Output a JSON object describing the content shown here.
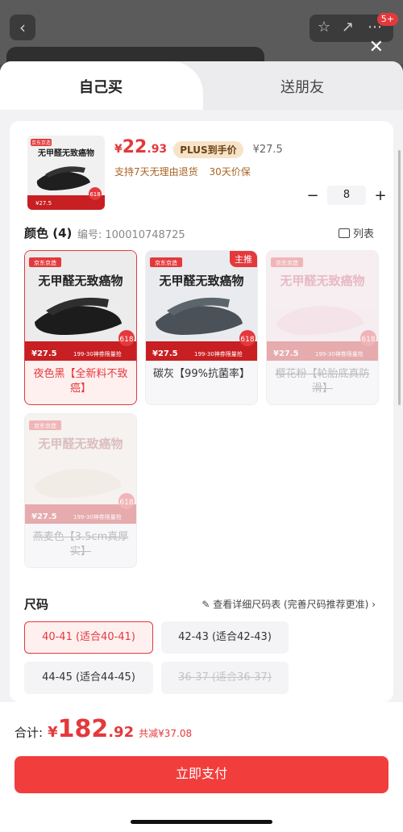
{
  "background": {
    "back_icon": "chevron-left-icon",
    "star_icon": "star-icon",
    "share_icon": "share-icon",
    "more_icon": "more-icon",
    "badge": "5+",
    "close_icon": "close-icon"
  },
  "tabs": [
    {
      "label": "自己买",
      "active": true
    },
    {
      "label": "送朋友",
      "active": false
    }
  ],
  "product": {
    "price_symbol": "¥",
    "price_int": "22",
    "price_dec": ".93",
    "plus_label": "PLUS到手价",
    "original_price": "¥27.5",
    "policy_return": "支持7天无理由退货",
    "policy_price": "30天价保",
    "quantity": "8",
    "minus": "−",
    "plus": "+"
  },
  "color_section": {
    "title": "颜色 (4)",
    "sku_label": "编号:",
    "sku_value": "100010748725",
    "list_label": "列表",
    "items": [
      {
        "label": "夜色黑【全新料不致癌】",
        "selected": true,
        "disabled": false,
        "tag": ""
      },
      {
        "label": "碳灰【99%抗菌率】",
        "selected": false,
        "disabled": false,
        "tag": "主推"
      },
      {
        "label": "樱花粉【轮胎底真防滑】",
        "selected": false,
        "disabled": true,
        "tag": ""
      },
      {
        "label": "燕麦色【3.5cm真厚实】",
        "selected": false,
        "disabled": true,
        "tag": ""
      }
    ]
  },
  "size_section": {
    "title": "尺码",
    "link": "查看详细尺码表 (完善尺码推荐更准)",
    "items": [
      {
        "label": "40-41 (适合40-41)",
        "selected": true,
        "disabled": false
      },
      {
        "label": "42-43 (适合42-43)",
        "selected": false,
        "disabled": false
      },
      {
        "label": "44-45 (适合44-45)",
        "selected": false,
        "disabled": false
      },
      {
        "label": "36-37 (适合36-37)",
        "selected": false,
        "disabled": true
      }
    ]
  },
  "footer": {
    "total_label": "合计:",
    "total_symbol": "¥",
    "total_int": "182",
    "total_dec": ".92",
    "saved": "共减¥37.08",
    "pay_button": "立即支付"
  },
  "colors": {
    "accent": "#e4393c",
    "plus_bg": "#f6e3c8",
    "policy": "#a86424"
  },
  "promo_image_text": {
    "banner": "无甲醛无致癌物",
    "store": "京东京造",
    "badge": "618",
    "price": "¥27.5",
    "coupon": "199-30神券限量抢"
  }
}
